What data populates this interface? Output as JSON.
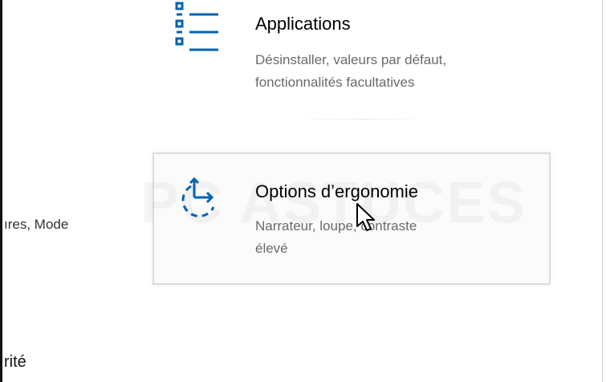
{
  "accent_color": "#0063b1",
  "applications": {
    "title": "Applications",
    "desc_line1": "Désinstaller, valeurs par défaut,",
    "desc_line2": "fonctionnalités facultatives",
    "icon": "apps-list-icon"
  },
  "ease_of_access": {
    "title": "Options d’ergonomie",
    "desc_line1": "Narrateur, loupe, contraste",
    "desc_line2": "élevé",
    "icon": "ease-of-access-icon"
  },
  "left_column": {
    "text1": "ıres, Mode",
    "text2": "rité"
  },
  "watermark": "PC ASTUCES",
  "cursor": "arrow-cursor-icon"
}
